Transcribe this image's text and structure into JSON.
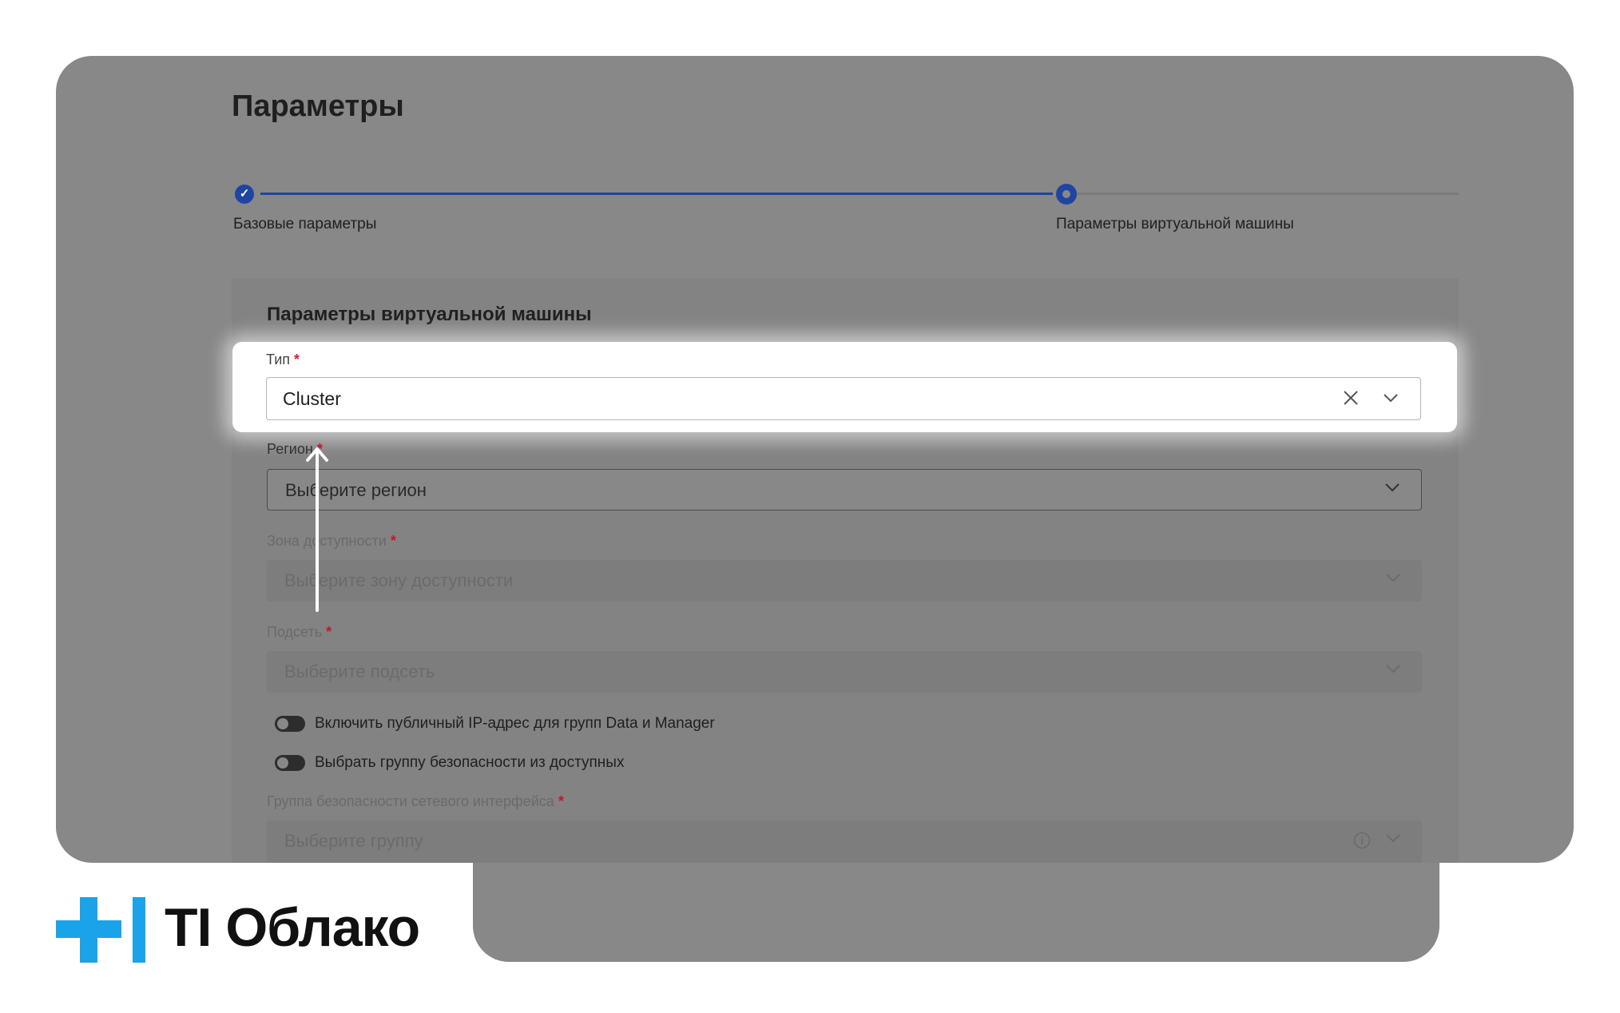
{
  "page": {
    "title": "Параметры"
  },
  "stepper": {
    "steps": [
      {
        "label": "Базовые параметры",
        "state": "done"
      },
      {
        "label": "Параметры виртуальной машины",
        "state": "active"
      }
    ]
  },
  "form": {
    "section_title": "Параметры виртуальной машины",
    "required_mark": "*",
    "type": {
      "label": "Тип",
      "value": "Cluster"
    },
    "region": {
      "label": "Регион",
      "placeholder": "Выберите регион"
    },
    "zone": {
      "label": "Зона доступности",
      "placeholder": "Выберите зону доступности"
    },
    "subnet": {
      "label": "Подсеть",
      "placeholder": "Выберите подсеть"
    },
    "toggles": [
      {
        "label": "Включить публичный IP-адрес для групп Data и Manager",
        "on": false
      },
      {
        "label": "Выбрать группу безопасности из доступных",
        "on": false
      }
    ],
    "security_group": {
      "label": "Группа безопасности сетевого интерфейса",
      "placeholder": "Выберите группу"
    }
  },
  "brand": {
    "name": "TI Облако",
    "accent": "#1aa3e8"
  },
  "colors": {
    "overlay": "#888888",
    "step_accent": "#1f45a3",
    "required": "#d0213a"
  }
}
